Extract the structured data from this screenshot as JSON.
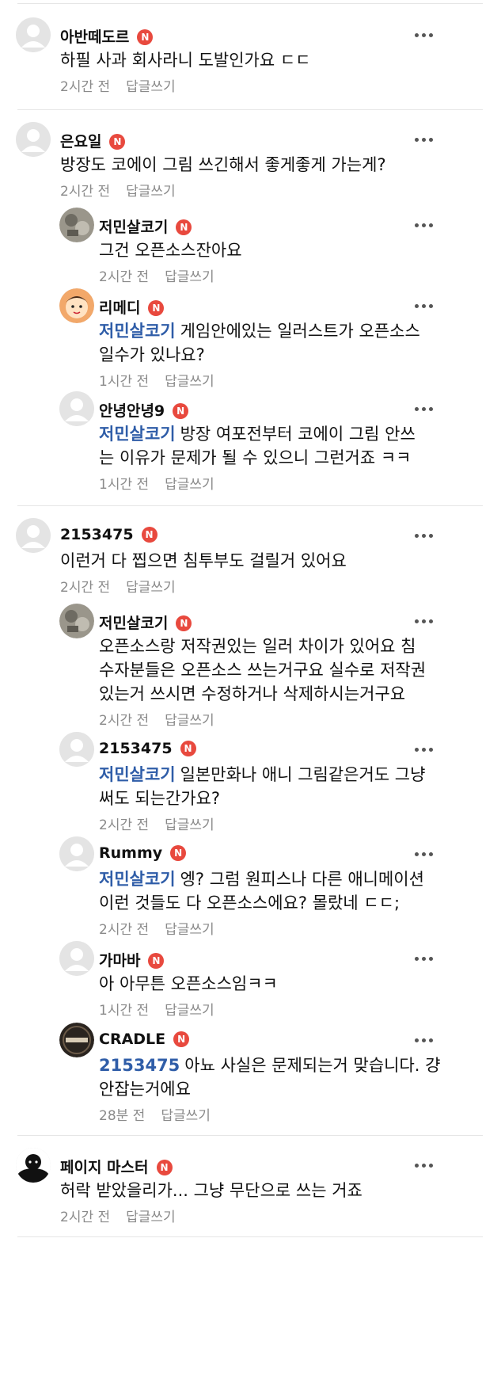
{
  "more_icon": "more-horizontal-icon",
  "badge_letter": "N",
  "badge_color": "#e8493e",
  "mention_color": "#2f5da8",
  "reply_label": "답글쓰기",
  "comments": [
    {
      "nick": "아반떼도르",
      "text": [
        "하필 사과 회사라니 도발인가요 ㄷㄷ"
      ],
      "time": "2시간 전",
      "avatar": "default"
    },
    {
      "nick": "은요일",
      "text": [
        "방장도 코에이 그림 쓰긴해서 좋게좋게 가는게?"
      ],
      "time": "2시간 전",
      "avatar": "default"
    },
    {
      "nick": "저민살코기",
      "text": [
        "그건 오픈소스잔아요"
      ],
      "time": "2시간 전",
      "avatar": "photo",
      "reply": true
    },
    {
      "nick": "리메디",
      "mention": "저민살코기",
      "text": [
        "게임안에있는 일러스트가 오픈소스",
        "일수가 있나요?"
      ],
      "time": "1시간 전",
      "avatar": "cartoon",
      "reply": true
    },
    {
      "nick": "안녕안녕9",
      "mention": "저민살코기",
      "text": [
        "방장 여포전부터 코에이 그림 안쓰",
        "는 이유가 문제가 될 수 있으니 그런거죠 ㅋㅋ"
      ],
      "time": "1시간 전",
      "avatar": "default",
      "reply": true
    },
    {
      "nick": "2153475",
      "text": [
        "이런거 다 찝으면 침투부도 걸릴거 있어요"
      ],
      "time": "2시간 전",
      "avatar": "default"
    },
    {
      "nick": "저민살코기",
      "text": [
        "오픈소스랑 저작권있는 일러 차이가 있어요 침",
        "수자분들은 오픈소스 쓰는거구요 실수로 저작권",
        "있는거 쓰시면 수정하거나 삭제하시는거구요"
      ],
      "time": "2시간 전",
      "avatar": "photo",
      "reply": true
    },
    {
      "nick": "2153475",
      "mention": "저민살코기",
      "text": [
        "일본만화나 애니 그림같은거도 그냥",
        "써도 되는간가요?"
      ],
      "time": "2시간 전",
      "avatar": "default",
      "reply": true
    },
    {
      "nick": "Rummy",
      "mention": "저민살코기",
      "text": [
        "엥? 그럼 원피스나 다른 애니메이션",
        "이런 것들도 다 오픈소스에요? 몰랐네 ㄷㄷ;"
      ],
      "time": "2시간 전",
      "avatar": "default",
      "reply": true
    },
    {
      "nick": "가마바",
      "text": [
        "아 아무튼 오픈소스임ㅋㅋ"
      ],
      "time": "1시간 전",
      "avatar": "default",
      "reply": true
    },
    {
      "nick": "CRADLE",
      "mention": "2153475",
      "text": [
        "아뇨 사실은 문제되는거 맞습니다. 걍",
        "안잡는거에요"
      ],
      "time": "28분 전",
      "avatar": "logo",
      "reply": true
    },
    {
      "nick": "페이지 마스터",
      "text": [
        "허락 받았을리가... 그냥 무단으로 쓰는 거죠"
      ],
      "time": "2시간 전",
      "avatar": "silhouette"
    }
  ]
}
